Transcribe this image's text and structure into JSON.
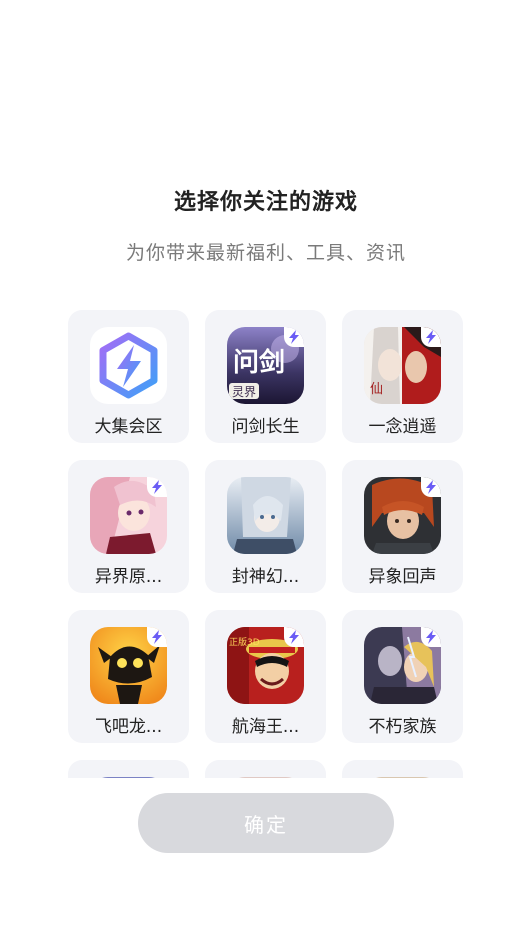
{
  "header": {
    "title": "选择你关注的游戏",
    "subtitle": "为你带来最新福利、工具、资讯"
  },
  "games": [
    {
      "name": "大集会区",
      "icon": "lightning-hexagon-app-icon",
      "badge": false
    },
    {
      "name": "问剑长生",
      "icon": "wenjian-game-icon",
      "badge": true,
      "icon_text": "问剑",
      "icon_subtext": "灵界"
    },
    {
      "name": "一念逍遥",
      "icon": "yinian-game-icon",
      "badge": true,
      "icon_text": "仙"
    },
    {
      "name": "异界原...",
      "icon": "yijie-game-icon",
      "badge": true
    },
    {
      "name": "封神幻...",
      "icon": "fengshen-game-icon",
      "badge": false
    },
    {
      "name": "异象回声",
      "icon": "yixiang-game-icon",
      "badge": true
    },
    {
      "name": "飞吧龙...",
      "icon": "feibalong-game-icon",
      "badge": true
    },
    {
      "name": "航海王...",
      "icon": "hanghaiwang-game-icon",
      "badge": true,
      "icon_text": "正版3D"
    },
    {
      "name": "不朽家族",
      "icon": "buxiu-game-icon",
      "badge": true
    },
    {
      "name": "",
      "icon": "game-icon",
      "badge": false
    },
    {
      "name": "",
      "icon": "game-icon",
      "badge": false
    },
    {
      "name": "",
      "icon": "game-icon",
      "badge": false
    }
  ],
  "confirm_button": {
    "label": "确定",
    "state": "disabled"
  },
  "colors": {
    "card_background": "#f3f4f8",
    "button_disabled": "#d8d9dd",
    "title": "#222222",
    "subtitle": "#7a7a7a",
    "badge_bolt": "#6a5cf5"
  }
}
